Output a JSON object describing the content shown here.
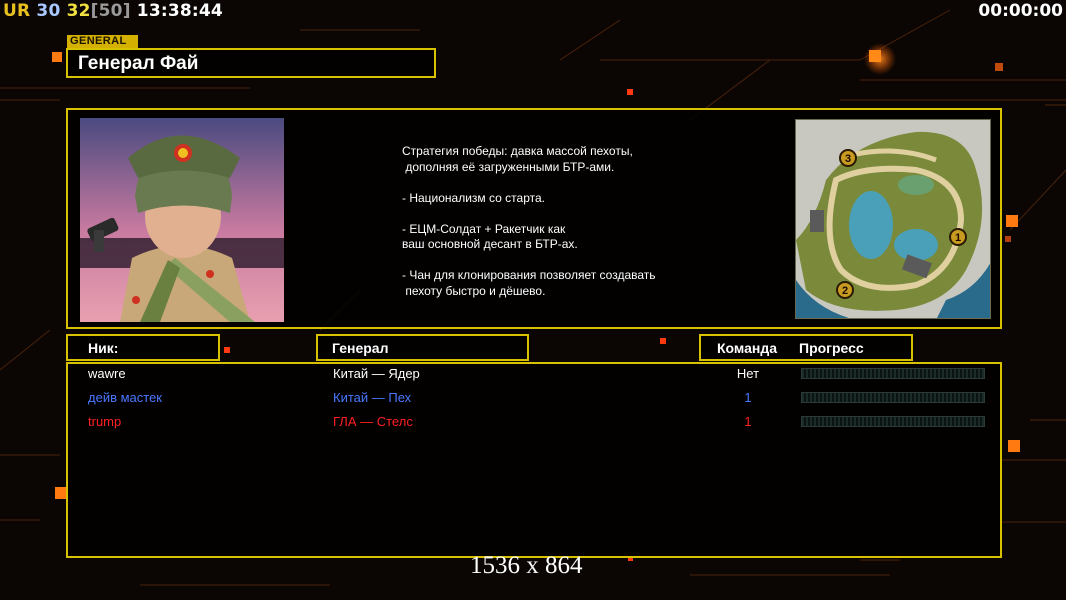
{
  "hud": {
    "tag": "UR",
    "num_a": "30",
    "num_b": "32",
    "num_c": "[50]",
    "clock": "13:38:44",
    "timer": "00:00:00"
  },
  "general": {
    "tag": "GENERAL",
    "name": "Генерал Фай",
    "description": "Стратегия победы: давка массой пехоты,\n дополняя её загруженными БТР-ами.\n\n- Национализм со старта.\n\n- ЕЦМ-Солдат + Ракетчик как\nваш основной десант в БТР-ах.\n\n- Чан для клонирования позволяет создавать\n пехоту быстро и дёшево."
  },
  "columns": {
    "nick": "Ник:",
    "general": "Генерал",
    "team": "Команда",
    "progress": "Прогресс"
  },
  "players": [
    {
      "nick": "wawre",
      "general": "Китай — Ядер",
      "team": "Нет",
      "progress": 0,
      "color": "#ffffff"
    },
    {
      "nick": "дейв мастек",
      "general": "Китай — Пех",
      "team": "1",
      "progress": 0,
      "color": "#4a78ff"
    },
    {
      "nick": "trump",
      "general": "ГЛА — Стелс",
      "team": "1",
      "progress": 0,
      "color": "#ff2020"
    }
  ],
  "minimap": {
    "spawns": [
      "1",
      "2",
      "3"
    ]
  },
  "resolution": "1536 x 864",
  "colors": {
    "frame": "#d8c200",
    "hud_tag": "#e8c020",
    "hud_a": "#a8c8ff",
    "hud_b": "#f0e040",
    "hud_c": "#9a9a9a",
    "accent_orange": "#ff7a10"
  }
}
